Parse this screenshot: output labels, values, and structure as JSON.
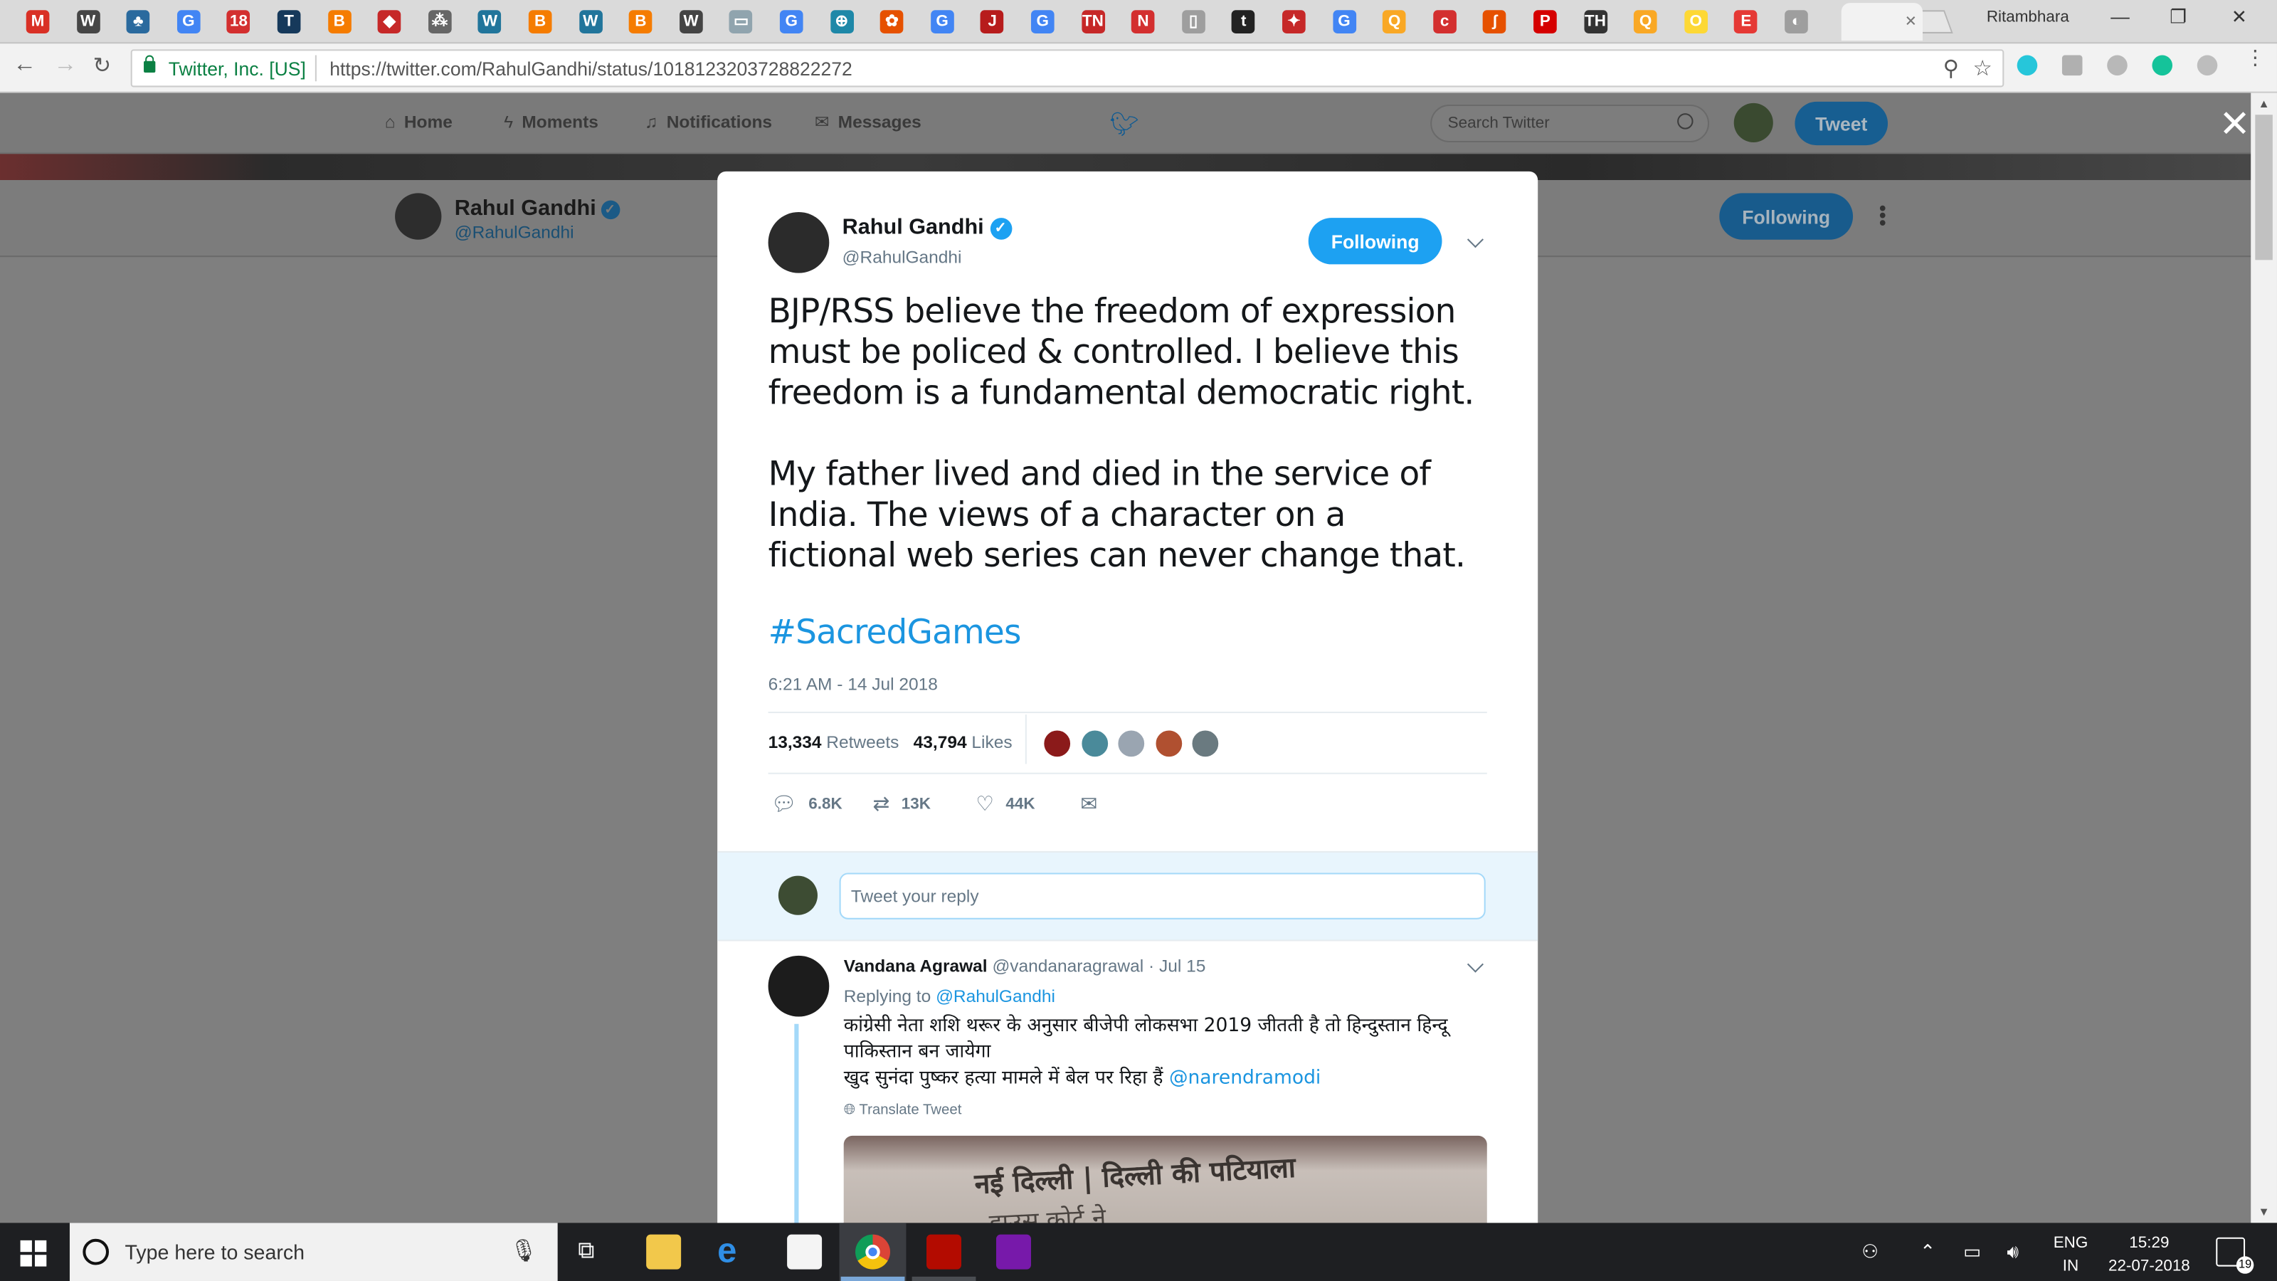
{
  "browser": {
    "profile_name": "Ritambhara",
    "site_identity": "Twitter, Inc. [US]",
    "url": "https://twitter.com/RahulGandhi/status/1018123203728822272",
    "tabs": [
      {
        "icon": "gmail-icon",
        "glyph": "M",
        "color": "#d93025"
      },
      {
        "icon": "wordpress-icon",
        "glyph": "W",
        "color": "#464646"
      },
      {
        "icon": "tree-icon",
        "glyph": "♣",
        "color": "#2a6a9e"
      },
      {
        "icon": "google-icon",
        "glyph": "G",
        "color": "#4285f4"
      },
      {
        "icon": "news18-icon",
        "glyph": "18",
        "color": "#d32f2f"
      },
      {
        "icon": "t-icon",
        "glyph": "T",
        "color": "#16395b"
      },
      {
        "icon": "blogger-icon",
        "glyph": "B",
        "color": "#f57c00"
      },
      {
        "icon": "diamond-icon",
        "glyph": "◆",
        "color": "#c62828"
      },
      {
        "icon": "grid-icon",
        "glyph": "⁂",
        "color": "#666"
      },
      {
        "icon": "wordpress-icon",
        "glyph": "W",
        "color": "#21759b"
      },
      {
        "icon": "blogger-icon",
        "glyph": "B",
        "color": "#f57c00"
      },
      {
        "icon": "wordpress-icon",
        "glyph": "W",
        "color": "#21759b"
      },
      {
        "icon": "blogger-icon",
        "glyph": "B",
        "color": "#f57c00"
      },
      {
        "icon": "wikipedia-icon",
        "glyph": "W",
        "color": "#444"
      },
      {
        "icon": "page-icon",
        "glyph": "▭",
        "color": "#90a4ae"
      },
      {
        "icon": "google-icon",
        "glyph": "G",
        "color": "#4285f4"
      },
      {
        "icon": "globe-icon",
        "glyph": "⊕",
        "color": "#1e88a8"
      },
      {
        "icon": "nbc-icon",
        "glyph": "✿",
        "color": "#e65100"
      },
      {
        "icon": "google-icon",
        "glyph": "G",
        "color": "#4285f4"
      },
      {
        "icon": "jagran-icon",
        "glyph": "J",
        "color": "#b71c1c"
      },
      {
        "icon": "google-icon",
        "glyph": "G",
        "color": "#4285f4"
      },
      {
        "icon": "tn-icon",
        "glyph": "TN",
        "color": "#c62828"
      },
      {
        "icon": "news-icon",
        "glyph": "N",
        "color": "#d32f2f"
      },
      {
        "icon": "document-icon",
        "glyph": "▯",
        "color": "#9e9e9e"
      },
      {
        "icon": "top-icon",
        "glyph": "t",
        "color": "#222"
      },
      {
        "icon": "star-icon",
        "glyph": "✦",
        "color": "#c62828"
      },
      {
        "icon": "google-icon",
        "glyph": "G",
        "color": "#4285f4"
      },
      {
        "icon": "quint-icon",
        "glyph": "Q",
        "color": "#f9a825"
      },
      {
        "icon": "c-icon",
        "glyph": "c",
        "color": "#d32f2f"
      },
      {
        "icon": "scroll-icon",
        "glyph": "ʃ",
        "color": "#e65100"
      },
      {
        "icon": "p-icon",
        "glyph": "P",
        "color": "#d50000"
      },
      {
        "icon": "th-icon",
        "glyph": "TH",
        "color": "#333"
      },
      {
        "icon": "quint-icon",
        "glyph": "Q",
        "color": "#f9a825"
      },
      {
        "icon": "o-icon",
        "glyph": "O",
        "color": "#fdd835"
      },
      {
        "icon": "e-icon",
        "glyph": "E",
        "color": "#e53935"
      },
      {
        "icon": "twitter-icon",
        "glyph": "◐",
        "color": "#9e9e9e"
      }
    ]
  },
  "twitter_nav": {
    "home": "Home",
    "moments": "Moments",
    "notifications": "Notifications",
    "messages": "Messages",
    "search_placeholder": "Search Twitter",
    "tweet_button": "Tweet"
  },
  "profile_bar": {
    "name": "Rahul Gandhi",
    "handle": "@RahulGandhi",
    "follow_state": "Following"
  },
  "tweet": {
    "author_name": "Rahul Gandhi",
    "author_handle": "@RahulGandhi",
    "follow_state": "Following",
    "paragraph1": "BJP/RSS believe the freedom of expression must be policed & controlled. I believe this freedom is a fundamental democratic right.",
    "paragraph2": "My father lived and died in the service of India. The views of a character on a fictional web series can never change that.",
    "hashtag": "#SacredGames",
    "timestamp": "6:21 AM - 14 Jul 2018",
    "retweets_count": "13,334",
    "retweets_label": "Retweets",
    "likes_count": "43,794",
    "likes_label": "Likes",
    "actions": {
      "replies": "6.8K",
      "retweets": "13K",
      "likes": "44K"
    },
    "liker_avatar_colors": [
      "#8b1a1a",
      "#4a8a9a",
      "#9aa5b1",
      "#b05030",
      "#6a7a80"
    ]
  },
  "reply_box": {
    "placeholder": "Tweet your reply"
  },
  "reply": {
    "name": "Vandana Agrawal",
    "handle": "@vandanaragrawal",
    "date": "· Jul 15",
    "replying_prefix": "Replying to",
    "replying_to": "@RahulGandhi",
    "line1": "कांग्रेसी नेता शशि थरूर के अनुसार बीजेपी लोकसभा 2019 जीतती है तो हिन्दुस्तान हिन्दू पाकिस्तान बन जायेगा",
    "line2": "खुद सुनंदा पुष्कर हत्या मामले में बेल पर रिहा हैं",
    "mention": "@narendramodi",
    "translate": "Translate Tweet",
    "media_text1": "नई दिल्ली | दिल्ली की पटियाला",
    "media_text2": "हाउस कोर्ट ने"
  },
  "taskbar": {
    "search_placeholder": "Type here to search",
    "lang_top": "ENG",
    "lang_bottom": "IN",
    "time": "15:29",
    "date": "22-07-2018",
    "notification_count": "19"
  }
}
